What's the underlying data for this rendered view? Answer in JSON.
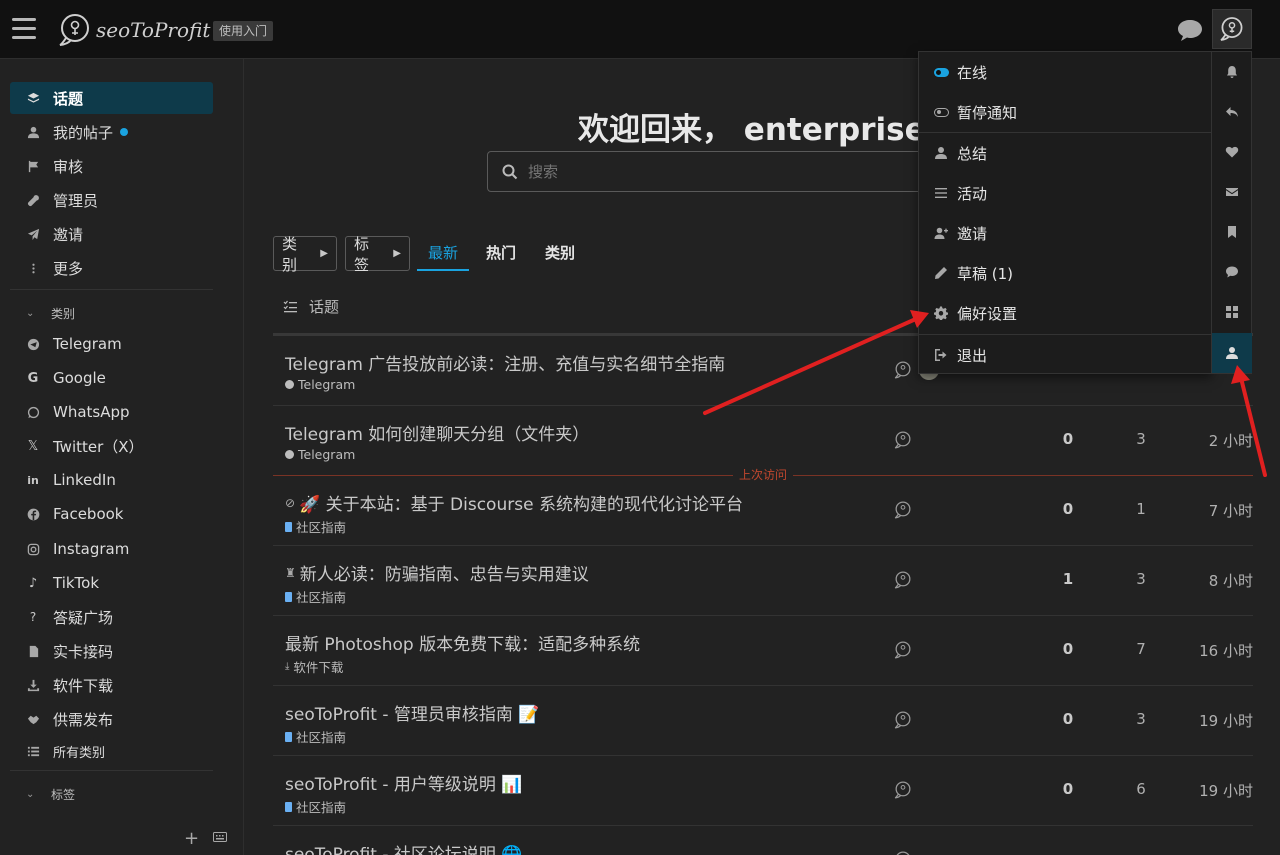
{
  "header": {
    "logo_text": "seoToProfit",
    "guide_label": "使用入门"
  },
  "sidebar": {
    "items": [
      {
        "label": "话题",
        "icon": "layers-icon"
      },
      {
        "label": "我的帖子",
        "icon": "user-icon"
      },
      {
        "label": "审核",
        "icon": "flag-icon"
      },
      {
        "label": "管理员",
        "icon": "wrench-icon"
      },
      {
        "label": "邀请",
        "icon": "paper-plane-icon"
      },
      {
        "label": "更多",
        "icon": "ellipsis-icon"
      }
    ],
    "categories_header": "类别",
    "categories": [
      {
        "label": "Telegram",
        "icon": "telegram-icon"
      },
      {
        "label": "Google",
        "icon": "google-icon"
      },
      {
        "label": "WhatsApp",
        "icon": "whatsapp-icon"
      },
      {
        "label": "Twitter（X）",
        "icon": "x-icon"
      },
      {
        "label": "LinkedIn",
        "icon": "linkedin-icon"
      },
      {
        "label": "Facebook",
        "icon": "facebook-icon"
      },
      {
        "label": "Instagram",
        "icon": "instagram-icon"
      },
      {
        "label": "TikTok",
        "icon": "tiktok-icon"
      },
      {
        "label": "答疑广场",
        "icon": "question-icon"
      },
      {
        "label": "实卡接码",
        "icon": "sim-card-icon"
      },
      {
        "label": "软件下载",
        "icon": "download-icon"
      },
      {
        "label": "供需发布",
        "icon": "handshake-icon"
      },
      {
        "label": "所有类别",
        "icon": "list-icon"
      }
    ],
    "tags_header": "标签"
  },
  "main": {
    "welcome": "欢迎回来， enterprise",
    "search_placeholder": "搜索",
    "filters": {
      "category": "类别",
      "tag": "标签"
    },
    "tabs": [
      "最新",
      "热门",
      "类别"
    ],
    "column_topic": "话题",
    "last_visit": "上次访问",
    "topics": [
      {
        "title": "Telegram 广告投放前必读：注册、充值与实名细节全指南",
        "category": "Telegram",
        "replies": "",
        "views": "",
        "activity": ""
      },
      {
        "title": "Telegram 如何创建聊天分组（文件夹）",
        "category": "Telegram",
        "replies": "0",
        "views": "3",
        "activity": "2 小时"
      },
      {
        "title": "🚀 关于本站：基于 Discourse 系统构建的现代化讨论平台",
        "category": "社区指南",
        "replies": "0",
        "views": "1",
        "activity": "7 小时"
      },
      {
        "title": "新人必读：防骗指南、忠告与实用建议",
        "category": "社区指南",
        "replies": "1",
        "views": "3",
        "activity": "8 小时"
      },
      {
        "title": "最新 Photoshop 版本免费下载：适配多种系统",
        "category": "软件下载",
        "replies": "0",
        "views": "7",
        "activity": "16 小时"
      },
      {
        "title": "seoToProfit - 管理员审核指南 📝",
        "category": "社区指南",
        "replies": "0",
        "views": "3",
        "activity": "19 小时"
      },
      {
        "title": "seoToProfit - 用户等级说明 📊",
        "category": "社区指南",
        "replies": "0",
        "views": "6",
        "activity": "19 小时"
      },
      {
        "title": "seoToProfit - 社区论坛说明 🌐",
        "category": "",
        "replies": "",
        "views": "",
        "activity": ""
      }
    ]
  },
  "user_menu": {
    "items": [
      {
        "label": "在线",
        "icon": "toggle-on-icon"
      },
      {
        "label": "暂停通知",
        "icon": "toggle-off-icon"
      },
      {
        "label": "总结",
        "icon": "user-icon"
      },
      {
        "label": "活动",
        "icon": "stream-icon"
      },
      {
        "label": "邀请",
        "icon": "user-plus-icon"
      },
      {
        "label": "草稿 (1)",
        "icon": "pencil-icon"
      },
      {
        "label": "偏好设置",
        "icon": "gear-icon"
      },
      {
        "label": "退出",
        "icon": "sign-out-icon"
      }
    ],
    "side_tabs": [
      "bell-icon",
      "reply-icon",
      "heart-icon",
      "envelope-icon",
      "bookmark-icon",
      "comment-icon",
      "grid-icon",
      "user-icon"
    ]
  },
  "colors": {
    "accent": "#1aa3e0",
    "active_bg": "#0e3a4a",
    "last_visit": "#c0472e",
    "annotation_arrow": "#e02020"
  }
}
